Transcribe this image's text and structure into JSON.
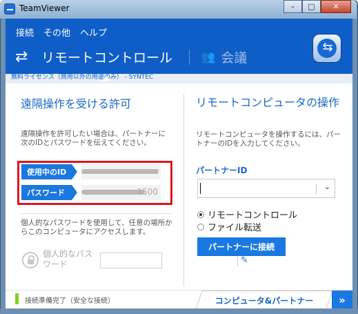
{
  "window": {
    "title": "TeamViewer",
    "min": "–",
    "max": "□",
    "close": "✕"
  },
  "menu": {
    "items": [
      "接続",
      "その他",
      "ヘルプ"
    ]
  },
  "tabs": {
    "remote": "リモートコントロール",
    "meeting": "会議"
  },
  "license": "無料ライセンス（商用以外の用途のみ） - SYNTEC",
  "left": {
    "title": "遠隔操作を受ける許可",
    "description": "遠隔操作を許可したい場合は、パートナーに次のIDとパスワードを伝えてください。",
    "id_label": "使用中のID",
    "id_value": "",
    "password_label": "パスワード",
    "password_value": "1500",
    "personal_desc": "個人的なパスワードを使用して、任意の場所からこのコンピュータにアクセスします。",
    "personal_pw_label": "個人的なパスワード"
  },
  "right": {
    "title": "リモートコンピュータの操作",
    "description": "リモートコンピュータを操作するには、パートナーのIDを入力してください。",
    "partner_id_label": "パートナーID",
    "partner_id_value": "",
    "option_remote": "リモートコントロール",
    "option_file": "ファイル転送",
    "selected_option": "リモートコントロール",
    "connect_button": "パートナーに接続"
  },
  "footer": {
    "status": "接続準備完了（安全な接続）",
    "status_color": "#7ed321",
    "computers_tab": "コンピュータ&パートナー",
    "expand": "»"
  },
  "colors": {
    "accent": "#1a78e0",
    "header": "#0f5ec7",
    "highlight": "#e0151b"
  },
  "icons": [
    "arrows-icon",
    "people-icon",
    "teamviewer-logo-icon",
    "lock-icon",
    "pencil-icon",
    "chevron-down-icon"
  ]
}
